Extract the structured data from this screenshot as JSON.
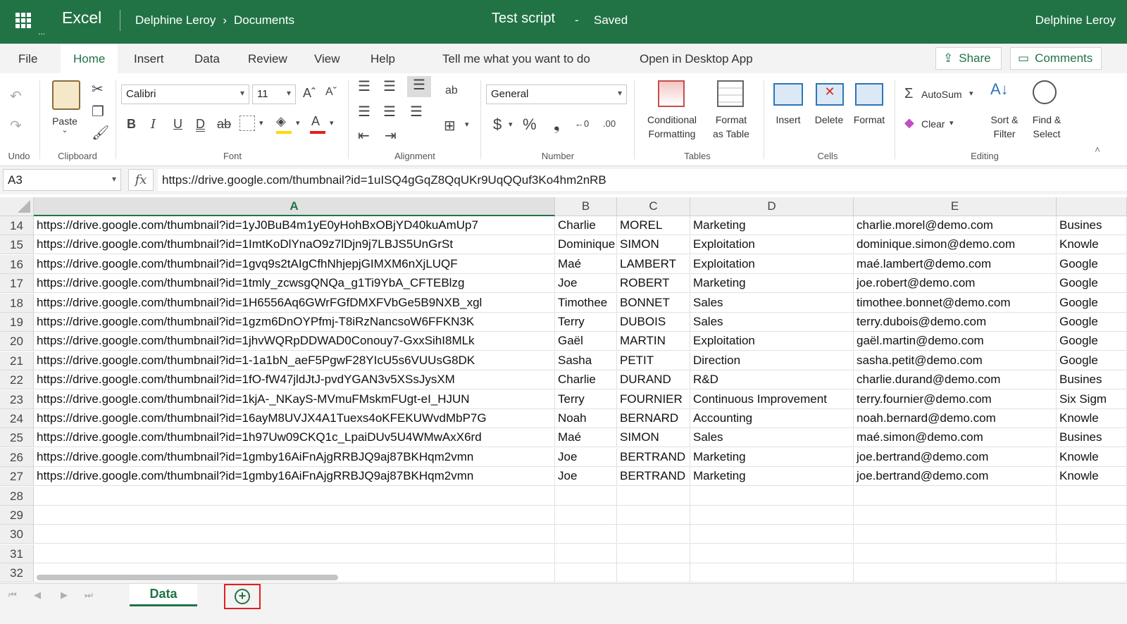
{
  "titlebar": {
    "app_name": "Excel",
    "owner": "Delphine Leroy",
    "breadcrumb_sep": "›",
    "folder": "Documents",
    "doc_title": "Test script",
    "dash": "-",
    "status": "Saved",
    "user": "Delphine Leroy",
    "more": "..."
  },
  "tabs": {
    "items": [
      "File",
      "Home",
      "Insert",
      "Data",
      "Review",
      "View",
      "Help"
    ],
    "active": "Home",
    "tell_me": "Tell me what you want to do",
    "open_desktop": "Open in Desktop App",
    "share": "Share",
    "comments": "Comments"
  },
  "ribbon": {
    "undo_group": "Undo",
    "clipboard_group": "Clipboard",
    "paste": "Paste",
    "font_group": "Font",
    "font_name": "Calibri",
    "font_size": "11",
    "alignment_group": "Alignment",
    "number_group": "Number",
    "number_format": "General",
    "tables_group": "Tables",
    "conditional_formatting_1": "Conditional",
    "conditional_formatting_2": "Formatting",
    "format_table_1": "Format",
    "format_table_2": "as Table",
    "cells_group": "Cells",
    "insert": "Insert",
    "delete": "Delete",
    "format": "Format",
    "editing_group": "Editing",
    "autosum": "AutoSum",
    "clear": "Clear",
    "sort_1": "Sort &",
    "sort_2": "Filter",
    "find_1": "Find &",
    "find_2": "Select",
    "bold": "B",
    "italic": "I",
    "underline": "U",
    "double_underline": "D",
    "strike": "ab",
    "currency": "$",
    "percent": "%",
    "comma": "❟",
    "inc_decimal": "←0",
    "dec_decimal": ".00",
    "grow_font": "Aˆ",
    "shrink_font": "Aˇ",
    "fill_color": "#ffd700",
    "font_color": "#e02020"
  },
  "formula_bar": {
    "name_box": "A3",
    "fx": "fx",
    "value": "https://drive.google.com/thumbnail?id=1uISQ4gGqZ8QqUKr9UqQQuf3Ko4hm2nRB"
  },
  "grid": {
    "columns": [
      "A",
      "B",
      "C",
      "D",
      "E",
      ""
    ],
    "selected_column": "A",
    "rows": [
      {
        "num": "14",
        "a": "https://drive.google.com/thumbnail?id=1yJ0BuB4m1yE0yHohBxOBjYD40kuAmUp7",
        "b": "Charlie",
        "c": "MOREL",
        "d": "Marketing",
        "e": "charlie.morel@demo.com",
        "f": "Busines"
      },
      {
        "num": "15",
        "a": "https://drive.google.com/thumbnail?id=1ImtKoDlYnaO9z7lDjn9j7LBJS5UnGrSt",
        "b": "Dominique",
        "c": "SIMON",
        "d": "Exploitation",
        "e": "dominique.simon@demo.com",
        "f": "Knowle"
      },
      {
        "num": "16",
        "a": "https://drive.google.com/thumbnail?id=1gvq9s2tAIgCfhNhjepjGIMXM6nXjLUQF",
        "b": "Maé",
        "c": "LAMBERT",
        "d": "Exploitation",
        "e": "maé.lambert@demo.com",
        "f": "Google"
      },
      {
        "num": "17",
        "a": "https://drive.google.com/thumbnail?id=1tmly_zcwsgQNQa_g1Ti9YbA_CFTEBlzg",
        "b": "Joe",
        "c": "ROBERT",
        "d": "Marketing",
        "e": "joe.robert@demo.com",
        "f": "Google"
      },
      {
        "num": "18",
        "a": "https://drive.google.com/thumbnail?id=1H6556Aq6GWrFGfDMXFVbGe5B9NXB_xgl",
        "b": "Timothee",
        "c": "BONNET",
        "d": "Sales",
        "e": "timothee.bonnet@demo.com",
        "f": "Google"
      },
      {
        "num": "19",
        "a": "https://drive.google.com/thumbnail?id=1gzm6DnOYPfmj-T8iRzNancsoW6FFKN3K",
        "b": "Terry",
        "c": "DUBOIS",
        "d": "Sales",
        "e": "terry.dubois@demo.com",
        "f": "Google"
      },
      {
        "num": "20",
        "a": "https://drive.google.com/thumbnail?id=1jhvWQRpDDWAD0Conouy7-GxxSihI8MLk",
        "b": "Gaël",
        "c": "MARTIN",
        "d": "Exploitation",
        "e": "gaël.martin@demo.com",
        "f": "Google"
      },
      {
        "num": "21",
        "a": "https://drive.google.com/thumbnail?id=1-1a1bN_aeF5PgwF28YIcU5s6VUUsG8DK",
        "b": "Sasha",
        "c": "PETIT",
        "d": "Direction",
        "e": "sasha.petit@demo.com",
        "f": "Google"
      },
      {
        "num": "22",
        "a": "https://drive.google.com/thumbnail?id=1fO-fW47jldJtJ-pvdYGAN3v5XSsJysXM",
        "b": "Charlie",
        "c": "DURAND",
        "d": "R&D",
        "e": "charlie.durand@demo.com",
        "f": "Busines"
      },
      {
        "num": "23",
        "a": "https://drive.google.com/thumbnail?id=1kjA-_NKayS-MVmuFMskmFUgt-eI_HJUN",
        "b": "Terry",
        "c": "FOURNIER",
        "d": "Continuous Improvement",
        "e": "terry.fournier@demo.com",
        "f": "Six Sigm"
      },
      {
        "num": "24",
        "a": "https://drive.google.com/thumbnail?id=16ayM8UVJX4A1Tuexs4oKFEKUWvdMbP7G",
        "b": "Noah",
        "c": "BERNARD",
        "d": "Accounting",
        "e": "noah.bernard@demo.com",
        "f": "Knowle"
      },
      {
        "num": "25",
        "a": "https://drive.google.com/thumbnail?id=1h97Uw09CKQ1c_LpaiDUv5U4WMwAxX6rd",
        "b": "Maé",
        "c": "SIMON",
        "d": "Sales",
        "e": "maé.simon@demo.com",
        "f": "Busines"
      },
      {
        "num": "26",
        "a": "https://drive.google.com/thumbnail?id=1gmby16AiFnAjgRRBJQ9aj87BKHqm2vmn",
        "b": "Joe",
        "c": "BERTRAND",
        "d": "Marketing",
        "e": "joe.bertrand@demo.com",
        "f": "Knowle"
      },
      {
        "num": "27",
        "a": "https://drive.google.com/thumbnail?id=1gmby16AiFnAjgRRBJQ9aj87BKHqm2vmn",
        "b": "Joe",
        "c": "BERTRAND",
        "d": "Marketing",
        "e": "joe.bertrand@demo.com",
        "f": "Knowle"
      },
      {
        "num": "28",
        "a": "",
        "b": "",
        "c": "",
        "d": "",
        "e": "",
        "f": ""
      },
      {
        "num": "29",
        "a": "",
        "b": "",
        "c": "",
        "d": "",
        "e": "",
        "f": ""
      },
      {
        "num": "30",
        "a": "",
        "b": "",
        "c": "",
        "d": "",
        "e": "",
        "f": ""
      },
      {
        "num": "31",
        "a": "",
        "b": "",
        "c": "",
        "d": "",
        "e": "",
        "f": ""
      },
      {
        "num": "32",
        "a": "",
        "b": "",
        "c": "",
        "d": "",
        "e": "",
        "f": ""
      }
    ]
  },
  "sheets": {
    "tabs": [
      "Data"
    ],
    "active": "Data",
    "add_icon": "+"
  },
  "colors": {
    "brand": "#217346",
    "highlight_box": "#e02020"
  }
}
